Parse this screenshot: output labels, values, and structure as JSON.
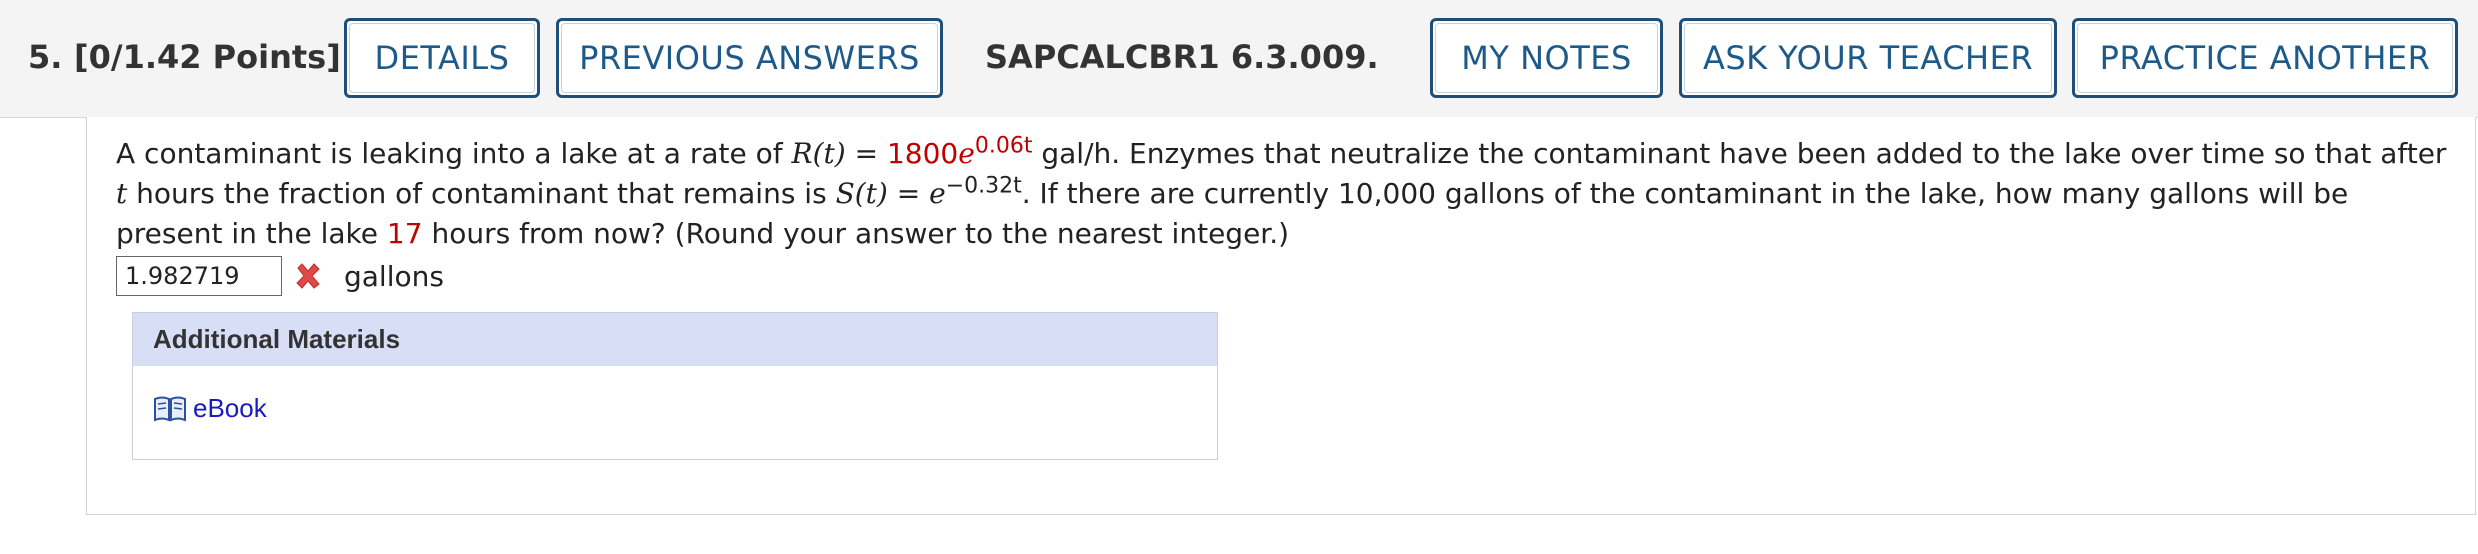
{
  "header": {
    "question_number": "5.",
    "points": "[0/1.42 Points]",
    "details_label": "DETAILS",
    "previous_answers_label": "PREVIOUS ANSWERS",
    "question_id": "SAPCALCBR1 6.3.009.",
    "my_notes_label": "MY NOTES",
    "ask_teacher_label": "ASK YOUR TEACHER",
    "practice_another_label": "PRACTICE ANOTHER"
  },
  "question": {
    "p1": "A contaminant is leaking into a lake at a rate of ",
    "rate_lhs": "R(t) = ",
    "rate_coef": "1800",
    "rate_base": "e",
    "rate_exp": "0.06t",
    "p2": " gal/h.  Enzymes that neutralize the contaminant have been added to the lake over time so that after ",
    "t_var": "t",
    "p3": " hours the fraction of contaminant that remains is ",
    "s_lhs": "S(t) = e",
    "s_exp": "−0.32t",
    "p4": ".  If there are currently 10,000 gallons of the contaminant in the lake, how many gallons will be present in the lake ",
    "hours": "17",
    "p5": " hours from now? (Round your answer to the nearest integer.)"
  },
  "answer": {
    "value": "1.982719",
    "unit": "gallons",
    "status": "incorrect"
  },
  "materials": {
    "heading": "Additional Materials",
    "ebook_label": "eBook"
  },
  "colors": {
    "button_border": "#1d4f79",
    "button_text": "#1d5a8a",
    "highlight_red": "#c00000",
    "materials_header_bg": "#d8def5",
    "link": "#1a1ac4"
  }
}
